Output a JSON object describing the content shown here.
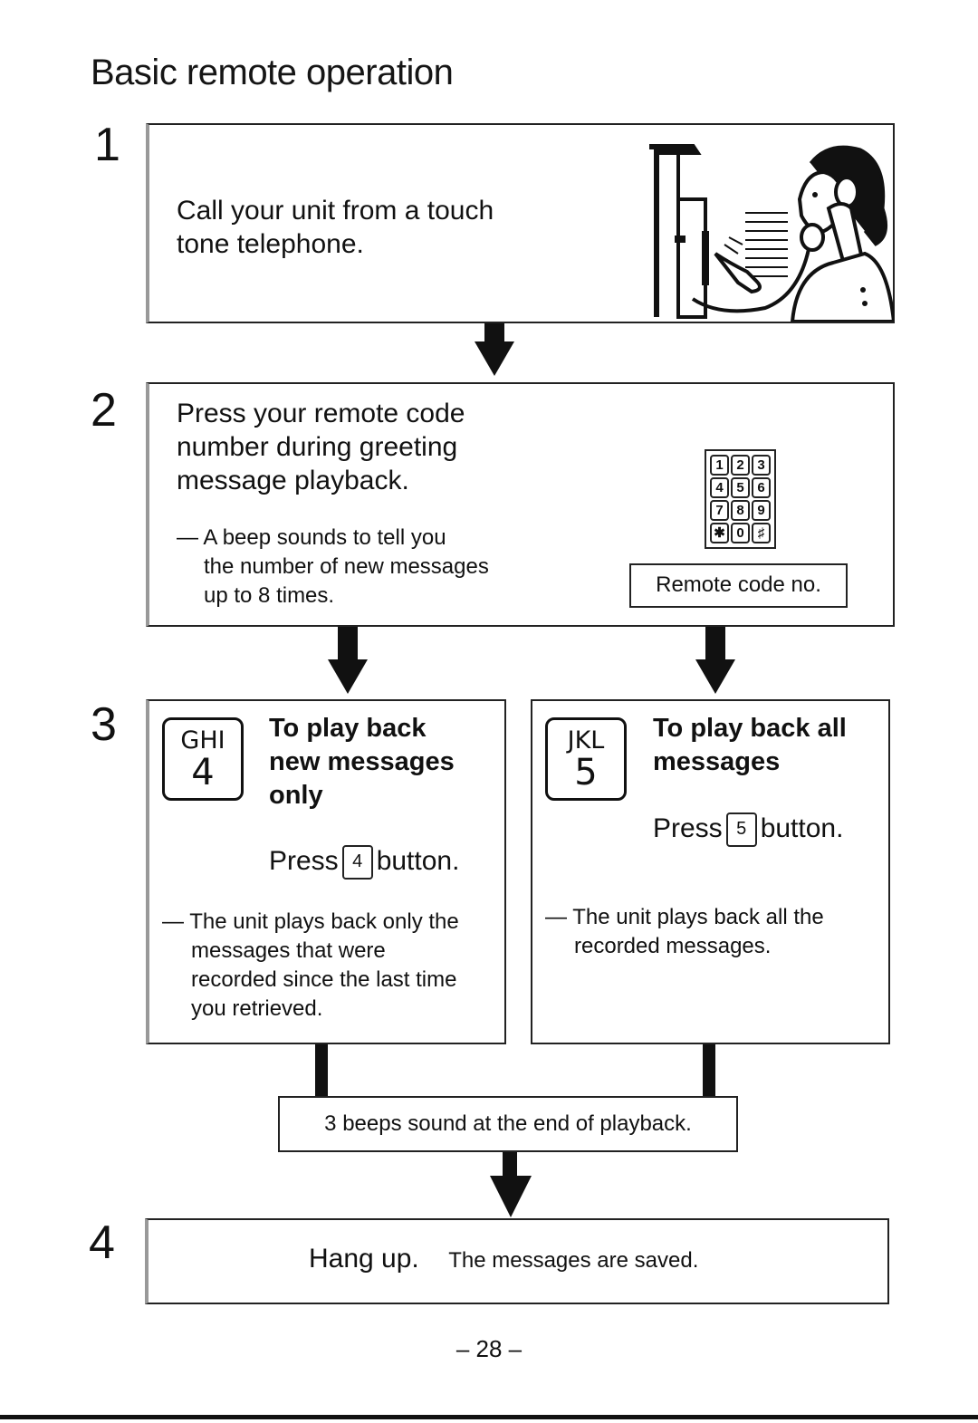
{
  "page": {
    "title": "Basic remote operation",
    "page_number": "– 28 –"
  },
  "steps": [
    {
      "number": "1",
      "text_lines": [
        "Call your unit from a touch",
        "tone telephone."
      ],
      "illustration": "woman-on-telephone-illustration"
    },
    {
      "number": "2",
      "text_lines": [
        "Press your remote code",
        "number during greeting",
        "message playback."
      ],
      "note_lines": [
        "— A beep sounds to tell you",
        "the number of new messages",
        "up to 8 times."
      ],
      "keypad_keys": [
        "1",
        "2",
        "3",
        "4",
        "5",
        "6",
        "7",
        "8",
        "9",
        "✱",
        "0",
        "♯"
      ],
      "keypad_label": "Remote code no."
    },
    {
      "number": "3",
      "options": [
        {
          "key_letters": "GHI",
          "key_digit": "4",
          "heading_lines": [
            "To play back",
            "new messages",
            "only"
          ],
          "press_prefix": "Press",
          "press_key": "4",
          "press_suffix": "button.",
          "note_lines": [
            "— The unit plays back only the",
            "messages that were",
            "recorded since the last time",
            "you retrieved."
          ]
        },
        {
          "key_letters": "JKL",
          "key_digit": "5",
          "heading_lines": [
            "To play back all",
            "messages"
          ],
          "press_prefix": "Press",
          "press_key": "5",
          "press_suffix": "button.",
          "note_lines": [
            "— The unit plays back all the",
            "recorded messages."
          ]
        }
      ],
      "merge_text": "3 beeps sound at the end of playback."
    },
    {
      "number": "4",
      "main_text": "Hang up.",
      "sub_text": "The messages are saved."
    }
  ]
}
